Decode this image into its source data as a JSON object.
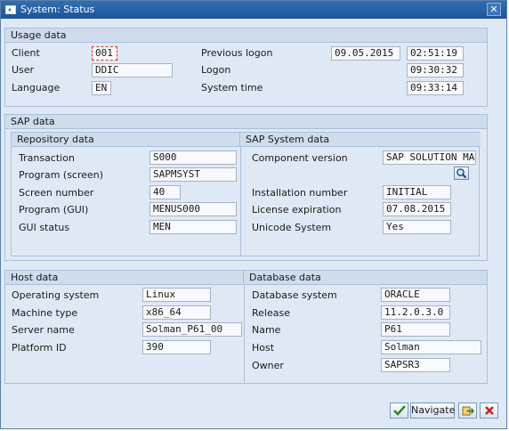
{
  "window": {
    "title": "System: Status",
    "close_glyph": "✕"
  },
  "usage": {
    "title": "Usage data",
    "client_label": "Client",
    "client_value": "001",
    "user_label": "User",
    "user_value": "DDIC",
    "language_label": "Language",
    "language_value": "EN",
    "prev_logon_label": "Previous logon",
    "prev_logon_date": "09.05.2015",
    "prev_logon_time": "02:51:19",
    "logon_label": "Logon",
    "logon_time": "09:30:32",
    "systime_label": "System time",
    "systime_value": "09:33:14"
  },
  "sap": {
    "title": "SAP data",
    "repo_title": "Repository data",
    "transaction_label": "Transaction",
    "transaction_value": "S000",
    "program_screen_label": "Program (screen)",
    "program_screen_value": "SAPMSYST",
    "screen_number_label": "Screen number",
    "screen_number_value": "40",
    "program_gui_label": "Program (GUI)",
    "program_gui_value": "MENUS000",
    "gui_status_label": "GUI status",
    "gui_status_value": "MEN",
    "system_title": "SAP System data",
    "component_label": "Component version",
    "component_value": "SAP SOLUTION MA...",
    "install_label": "Installation number",
    "install_value": "INITIAL",
    "license_label": "License expiration",
    "license_value": "07.08.2015",
    "unicode_label": "Unicode System",
    "unicode_value": "Yes"
  },
  "host": {
    "title": "Host data",
    "os_label": "Operating system",
    "os_value": "Linux",
    "machine_label": "Machine type",
    "machine_value": "x86_64",
    "server_label": "Server name",
    "server_value": "Solman_P61_00",
    "platform_label": "Platform ID",
    "platform_value": "390"
  },
  "db": {
    "title": "Database data",
    "system_label": "Database system",
    "system_value": "ORACLE",
    "release_label": "Release",
    "release_value": "11.2.0.3.0",
    "name_label": "Name",
    "name_value": "P61",
    "host_label": "Host",
    "host_value": "Solman",
    "owner_label": "Owner",
    "owner_value": "SAPSR3"
  },
  "footer": {
    "navigate_label": "Navigate"
  },
  "colors": {
    "accent": "#1d5496",
    "panel": "#dfe9f5",
    "ok_green": "#2e8b1e",
    "cancel_red": "#c8261c"
  },
  "icons": {
    "window": "window-icon",
    "details": "magnifier-icon",
    "ok": "check-icon",
    "navigate": "navigate-icon",
    "export": "export-icon",
    "cancel": "cancel-icon"
  }
}
